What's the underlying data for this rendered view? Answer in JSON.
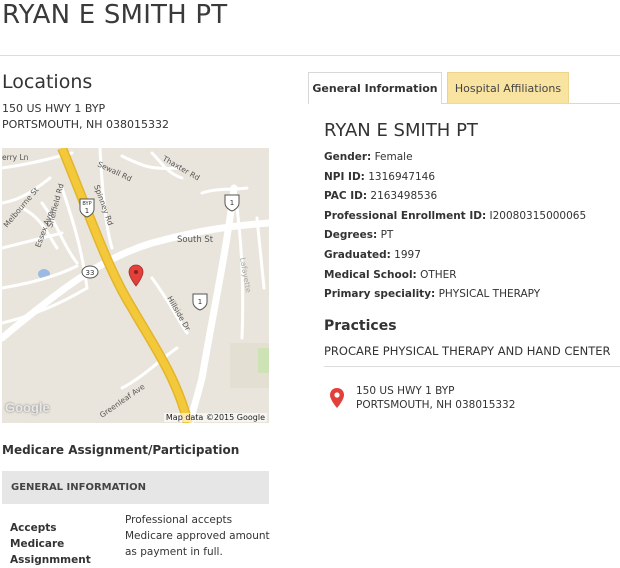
{
  "page": {
    "title": "RYAN E SMITH PT"
  },
  "locations": {
    "heading": "Locations",
    "address_line1": "150 US HWY 1 BYP",
    "address_line2": "PORTSMOUTH, NH 038015332"
  },
  "map": {
    "labels": {
      "sewall": "Sewall Rd",
      "thaxter": "Thaxter Rd",
      "spinney": "Spinney Rd",
      "melbourne": "Melbourne St",
      "sheffield": "Sheffield Rd",
      "essex": "Essex Ave",
      "south": "South St",
      "hillside": "Hillside Dr",
      "greenleaf": "Greenleaf Ave",
      "ry": "erry Ln",
      "shield_1": "1",
      "shield_byp": "BYP",
      "shield_33": "33"
    },
    "logo": "Google",
    "credit": "Map data ©2015 Google"
  },
  "medicare": {
    "heading": "Medicare Assignment/Participation",
    "section_title": "GENERAL INFORMATION",
    "row_label": "Accepts Medicare Assignmment",
    "row_value": "Professional accepts Medicare approved amount as payment in full."
  },
  "tabs": [
    {
      "label": "General Information",
      "active": true
    },
    {
      "label": "Hospital Affiliations",
      "active": false
    }
  ],
  "provider": {
    "name": "RYAN E SMITH PT",
    "fields": [
      {
        "label": "Gender:",
        "value": "Female"
      },
      {
        "label": "NPI ID:",
        "value": "1316947146"
      },
      {
        "label": "PAC ID:",
        "value": "2163498536"
      },
      {
        "label": "Professional Enrollment ID:",
        "value": "I20080315000065"
      },
      {
        "label": "Degrees:",
        "value": "PT"
      },
      {
        "label": "Graduated:",
        "value": "1997"
      },
      {
        "label": "Medical School:",
        "value": "OTHER"
      },
      {
        "label": "Primary speciality:",
        "value": "PHYSICAL THERAPY"
      }
    ]
  },
  "practices": {
    "heading": "Practices",
    "name": "PROCARE PHYSICAL THERAPY AND HAND CENTER",
    "address_line1": "150 US HWY 1 BYP",
    "address_line2": "PORTSMOUTH, NH 038015332"
  },
  "colors": {
    "tab_inactive_bg": "#f9e3a0",
    "pin": "#e2403b",
    "highway": "#f3c93b"
  }
}
